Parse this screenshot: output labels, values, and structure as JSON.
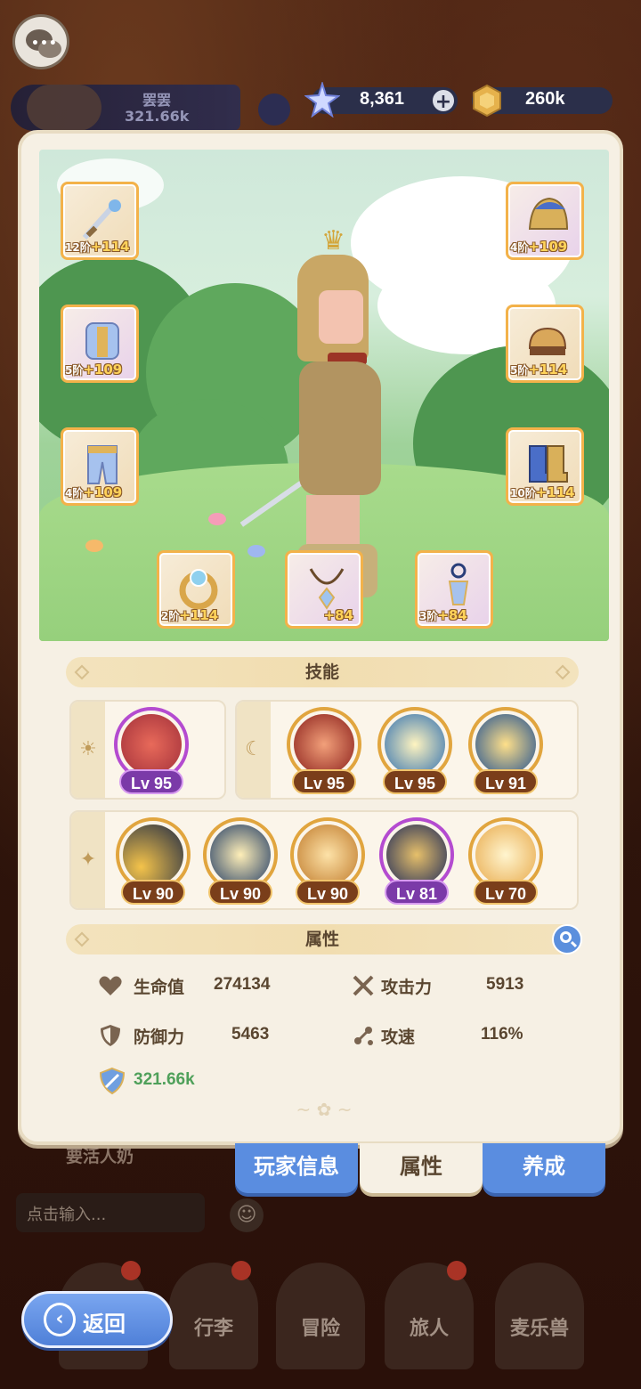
{
  "top": {
    "player_name": "罢罢",
    "player_power": "321.66k",
    "gems": "8,361",
    "coins": "260k"
  },
  "equipment": [
    {
      "tier": "12阶",
      "plus": "+114",
      "icon": "sword-icon",
      "rarity": "gold"
    },
    {
      "tier": "4阶",
      "plus": "+109",
      "icon": "helmet-icon",
      "rarity": "purple"
    },
    {
      "tier": "5阶",
      "plus": "+109",
      "icon": "armor-icon",
      "rarity": "purple"
    },
    {
      "tier": "5阶",
      "plus": "+114",
      "icon": "gloves-icon",
      "rarity": "gold"
    },
    {
      "tier": "4阶",
      "plus": "+109",
      "icon": "pants-icon",
      "rarity": "gold"
    },
    {
      "tier": "10阶",
      "plus": "+114",
      "icon": "boots-icon",
      "rarity": "gold"
    },
    {
      "tier": "2阶",
      "plus": "+114",
      "icon": "ring-icon",
      "rarity": "gold"
    },
    {
      "tier": "",
      "plus": "+84",
      "icon": "necklace-icon",
      "rarity": "purple"
    },
    {
      "tier": "3阶",
      "plus": "+84",
      "icon": "amulet-icon",
      "rarity": "purple"
    }
  ],
  "skills_title": "技能",
  "skills_row1_left": [
    {
      "level": "Lv 95",
      "style": "pur"
    }
  ],
  "skills_row1_right": [
    {
      "level": "Lv 95",
      "style": "gold"
    },
    {
      "level": "Lv 95",
      "style": "gold"
    },
    {
      "level": "Lv 91",
      "style": "gold"
    }
  ],
  "skills_row2": [
    {
      "level": "Lv 90",
      "style": "gold"
    },
    {
      "level": "Lv 90",
      "style": "gold"
    },
    {
      "level": "Lv 90",
      "style": "gold"
    },
    {
      "level": "Lv 81",
      "style": "pur"
    },
    {
      "level": "Lv 70",
      "style": "gold"
    }
  ],
  "attributes_title": "属性",
  "stats": {
    "hp_label": "生命值",
    "hp_value": "274134",
    "atk_label": "攻击力",
    "atk_value": "5913",
    "def_label": "防御力",
    "def_value": "5463",
    "spd_label": "攻速",
    "spd_value": "116%",
    "power_value": "321.66k"
  },
  "tabs": {
    "player_info": "玩家信息",
    "attributes": "属性",
    "develop": "养成"
  },
  "chat": {
    "last_message": "要活人奶",
    "input_placeholder": "点击输入..."
  },
  "nav": {
    "back": "返回",
    "luggage": "行李",
    "adventure": "冒险",
    "traveler": "旅人",
    "pet": "麦乐兽"
  },
  "colors": {
    "accent_blue": "#5a8de0",
    "panel_bg": "#f6f0e4",
    "gold_border": "#f3b24a",
    "power_green": "#4fa05a"
  }
}
